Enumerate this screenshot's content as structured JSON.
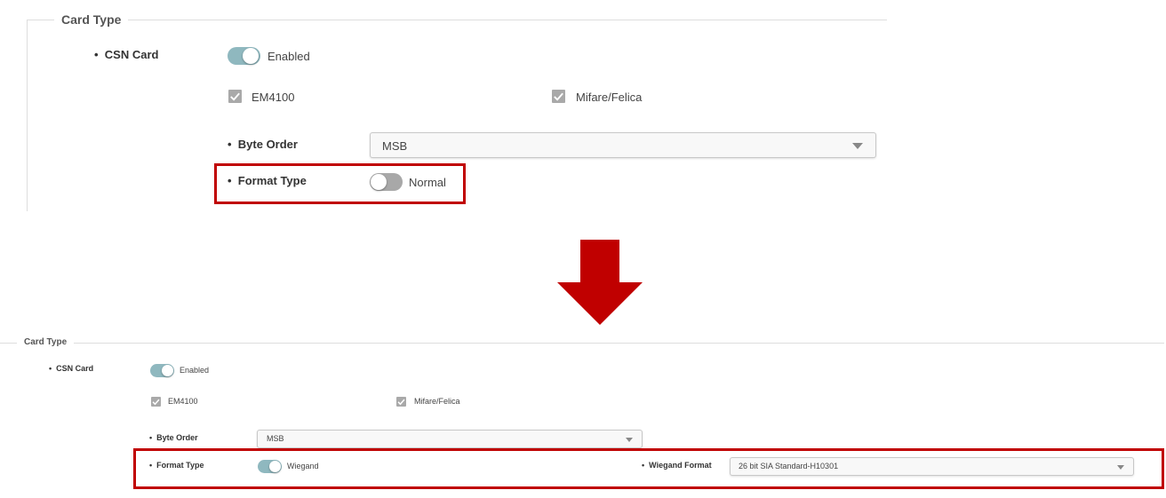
{
  "before": {
    "section_title": "Card Type",
    "csn_card_label": "CSN Card",
    "csn_card_status": "Enabled",
    "em4100_label": "EM4100",
    "mifare_label": "Mifare/Felica",
    "byte_order_label": "Byte Order",
    "byte_order_value": "MSB",
    "format_type_label": "Format Type",
    "format_type_value": "Normal"
  },
  "after": {
    "section_title": "Card Type",
    "csn_card_label": "CSN Card",
    "csn_card_status": "Enabled",
    "em4100_label": "EM4100",
    "mifare_label": "Mifare/Felica",
    "byte_order_label": "Byte Order",
    "byte_order_value": "MSB",
    "format_type_label": "Format Type",
    "format_type_value": "Wiegand",
    "wiegand_format_label": "Wiegand Format",
    "wiegand_format_value": "26 bit SIA Standard-H10301"
  },
  "colors": {
    "highlight": "#c00000",
    "toggle_on": "#8fb8bf",
    "toggle_off": "#a8a8a8",
    "arrow": "#c00000"
  },
  "icons": [
    "arrow-down-icon",
    "check-icon",
    "chevron-down-icon"
  ]
}
